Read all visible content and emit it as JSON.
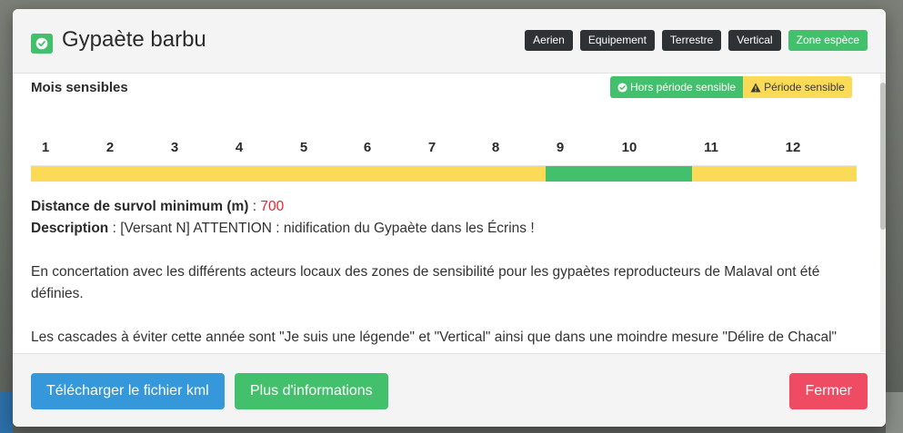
{
  "modal": {
    "title": "Gypaète barbu",
    "tags": [
      "Aerien",
      "Equipement",
      "Terrestre",
      "Vertical",
      "Zone espèce"
    ],
    "colors": {
      "green": "#43c06b",
      "yellow": "#fada57",
      "dark": "#2f3235",
      "blue": "#3498db",
      "red": "#ef4b62"
    }
  },
  "months_section": {
    "title": "Mois sensibles",
    "legend_ok": "Hors période sensible",
    "legend_warn": "Période sensible",
    "months": [
      "1",
      "2",
      "3",
      "4",
      "5",
      "6",
      "7",
      "8",
      "9",
      "10",
      "11",
      "12"
    ],
    "sensitivity": [
      "sensible",
      "sensible",
      "sensible",
      "sensible",
      "sensible",
      "sensible",
      "sensible",
      "sensible",
      "hors",
      "hors",
      "sensible",
      "sensible"
    ]
  },
  "details": {
    "distance_label": "Distance de survol minimum (m)",
    "distance_sep": " : ",
    "distance_value": "700",
    "description_label": "Description",
    "description_sep": " : ",
    "description_text": "[Versant N] ATTENTION : nidification du Gypaète dans les Écrins !",
    "paragraph_1": "En concertation avec les différents acteurs locaux des zones de sensibilité pour les gypaètes reproducteurs de Malaval ont été définies.",
    "paragraph_2": "Les cascades à éviter cette année sont \"Je suis une légende\" et \"Vertical\" ainsi que dans une moindre mesure \"Délire de Chacal\""
  },
  "footer": {
    "download_label": "Télécharger le fichier kml",
    "more_info_label": "Plus d'informations",
    "close_label": "Fermer"
  }
}
